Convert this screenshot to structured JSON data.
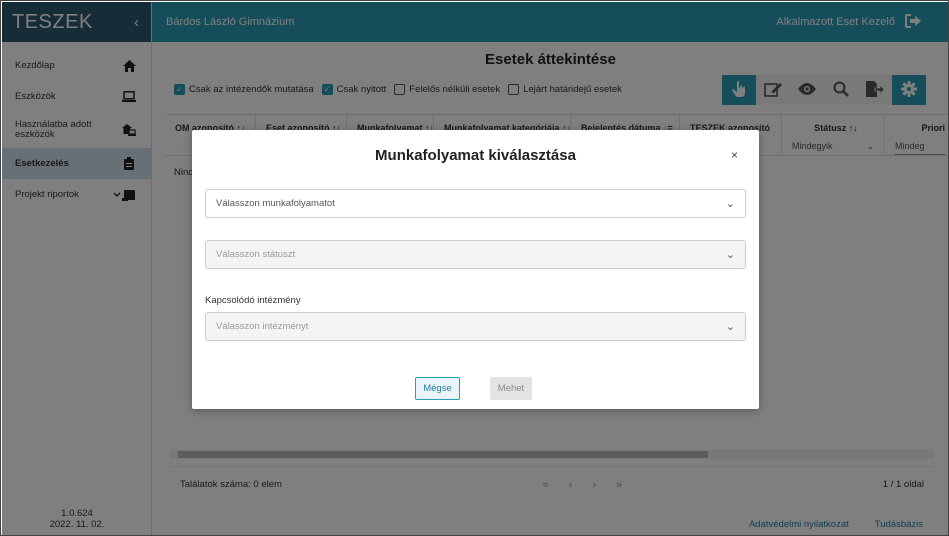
{
  "app": {
    "logo": "TESZEK",
    "collapse_icon": "chevron-left-icon",
    "school_name": "Bárdos László Gimnázium",
    "user_role": "Alkalmazott Eset Kezelő",
    "logout_icon": "logout-icon"
  },
  "sidebar": {
    "items": [
      {
        "label": "Kezdőlap",
        "icon": "home-icon"
      },
      {
        "label": "Eszközök",
        "icon": "laptop-icon"
      },
      {
        "label": "Használatba adott eszközök",
        "icon": "house-laptop-icon"
      },
      {
        "label": "Esetkezelés",
        "icon": "clipboard-icon",
        "active": true
      },
      {
        "label": "Projekt riportok",
        "icon": "chevron-down-scroll-icon"
      }
    ],
    "version": "1.0.624",
    "date": "2022. 11. 02."
  },
  "main": {
    "title": "Esetek áttekintése",
    "filters": [
      {
        "label": "Csak az intézendők mutatása",
        "checked": true
      },
      {
        "label": "Csak nyitott",
        "checked": true
      },
      {
        "label": "Felelős nélküli esetek",
        "checked": false
      },
      {
        "label": "Lejárt határidejű esetek",
        "checked": false
      }
    ],
    "toolbar": [
      "hand-pointer-icon",
      "edit-icon",
      "eye-icon",
      "search-icon",
      "export-icon",
      "gear-icon"
    ],
    "columns": [
      {
        "label": "OM azonosító",
        "sort": "↑↓"
      },
      {
        "label": "Eset azonosító",
        "sort": "↑↓"
      },
      {
        "label": "Munkafolyamat",
        "sort": "↑↓"
      },
      {
        "label": "Munkafolyamat kategóriája",
        "sort": "↑↓"
      },
      {
        "label": "Bejelentés dátuma",
        "sort": "↓="
      },
      {
        "label": "TESZEK azonosító",
        "sort": ""
      },
      {
        "label": "Státusz",
        "sort": "↑↓",
        "filter": "Mindegyik"
      },
      {
        "label": "Priori",
        "sort": "",
        "filter": "Mindeg"
      }
    ],
    "empty_text": "Ninc",
    "results_count": "Találatok száma: 0 elem",
    "pager": [
      "«",
      "‹",
      "›",
      "»"
    ],
    "page_info": "1 / 1 oldal",
    "links": [
      "Adatvédelmi nyilatkozat",
      "Tudásbázis"
    ]
  },
  "modal": {
    "title": "Munkafolyamat kiválasztása",
    "close": "×",
    "workflow_placeholder": "Válasszon munkafolyamatot",
    "status_placeholder": "Válasszon státuszt",
    "institution_label": "Kapcsolódó intézmény",
    "institution_placeholder": "Válasszon intézményt",
    "cancel_label": "Mégse",
    "go_label": "Mehet"
  }
}
